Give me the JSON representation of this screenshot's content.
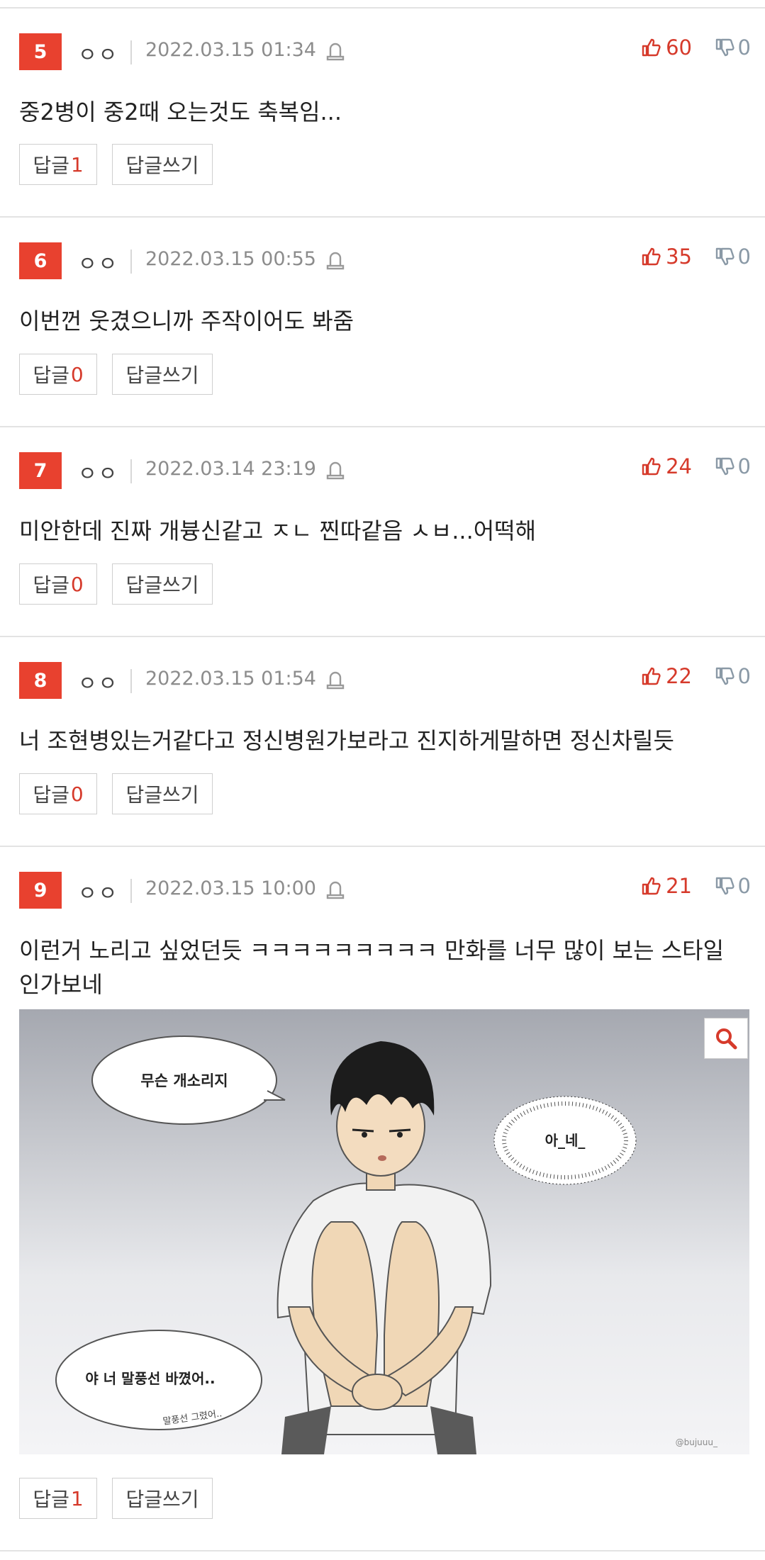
{
  "comments": [
    {
      "rank": "5",
      "author": "ㅇㅇ",
      "date": "2022.03.15 01:34",
      "likes": "60",
      "dislikes": "0",
      "text": "중2병이 중2때 오는것도 축복임...",
      "reply_label": "답글",
      "reply_count": "1",
      "write_label": "답글쓰기"
    },
    {
      "rank": "6",
      "author": "ㅇㅇ",
      "date": "2022.03.15 00:55",
      "likes": "35",
      "dislikes": "0",
      "text": "이번껀 웃겼으니까 주작이어도 봐줌",
      "reply_label": "답글",
      "reply_count": "0",
      "write_label": "답글쓰기"
    },
    {
      "rank": "7",
      "author": "ㅇㅇ",
      "date": "2022.03.14 23:19",
      "likes": "24",
      "dislikes": "0",
      "text": "미안한데 진짜 개븅신같고 ㅈㄴ 찐따같음 ㅅㅂ...어떡해",
      "reply_label": "답글",
      "reply_count": "0",
      "write_label": "답글쓰기"
    },
    {
      "rank": "8",
      "author": "ㅇㅇ",
      "date": "2022.03.15 01:54",
      "likes": "22",
      "dislikes": "0",
      "text": "너 조현병있는거같다고 정신병원가보라고 진지하게말하면 정신차릴듯",
      "reply_label": "답글",
      "reply_count": "0",
      "write_label": "답글쓰기"
    },
    {
      "rank": "9",
      "author": "ㅇㅇ",
      "date": "2022.03.15 10:00",
      "likes": "21",
      "dislikes": "0",
      "text": "이런거 노리고 싶었던듯 ㅋㅋㅋㅋㅋㅋㅋㅋㅋ 만화를 너무 많이 보는 스타일인가보네",
      "reply_label": "답글",
      "reply_count": "1",
      "write_label": "답글쓰기"
    }
  ],
  "image": {
    "bubble_1": "무슨 개소리지",
    "bubble_2": "아_네_",
    "bubble_3": "야 너 말풍선 바꼈어..",
    "small_note": "말풍선 그렸어..",
    "watermark": "@bujuuu_"
  },
  "colors": {
    "accent": "#e8412f",
    "like": "#d63a2b",
    "dislike": "#8a99a6"
  }
}
